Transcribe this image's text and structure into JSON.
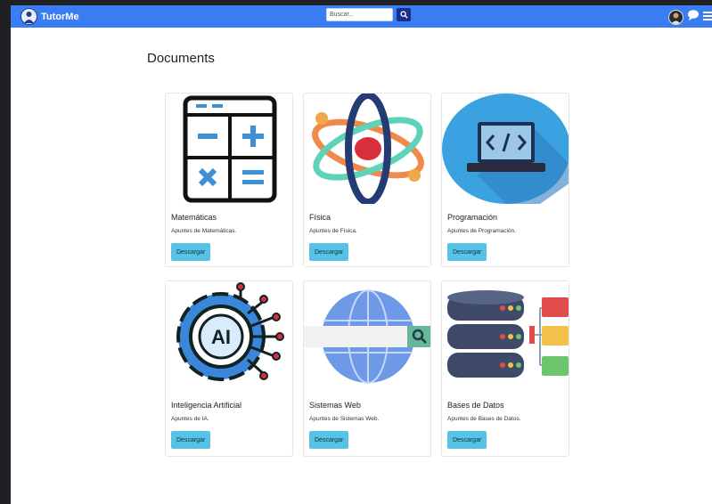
{
  "brand": {
    "name": "TutorMe"
  },
  "search": {
    "placeholder": "Buscar..."
  },
  "page": {
    "title": "Documents"
  },
  "cards": [
    {
      "title": "Matemáticas",
      "description": "Apuntes de Matemáticas.",
      "button": "Descargar",
      "icon": "calculator-icon"
    },
    {
      "title": "Física",
      "description": "Apuntes de Física.",
      "button": "Descargar",
      "icon": "atom-icon"
    },
    {
      "title": "Programación",
      "description": "Apuntes de Programación.",
      "button": "Descargar",
      "icon": "code-laptop-icon"
    },
    {
      "title": "Inteligencia Artificial",
      "description": "Apuntes de IA.",
      "button": "Descargar",
      "icon": "ai-gear-icon"
    },
    {
      "title": "Sistemas Web",
      "description": "Apuntes de Sistemas Web.",
      "button": "Descargar",
      "icon": "globe-search-icon"
    },
    {
      "title": "Bases de Datos",
      "description": "Apuntes de Bases de Datos.",
      "button": "Descargar",
      "icon": "database-icon"
    }
  ],
  "colors": {
    "navbar": "#3a7cf2",
    "button": "#56c2e6",
    "search_button": "#1b2d8f"
  }
}
